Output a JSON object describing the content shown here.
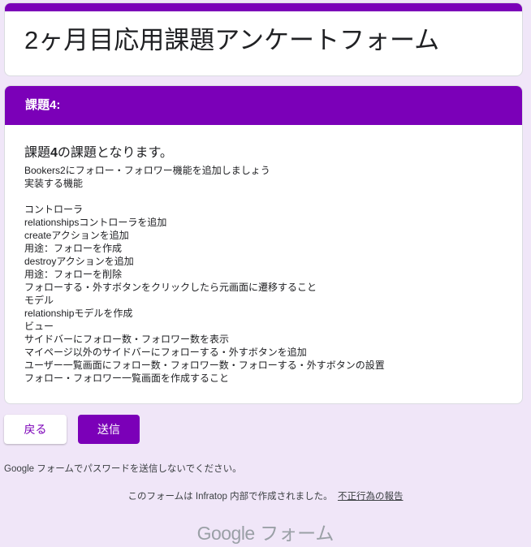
{
  "form": {
    "title": "2ヶ月目応用課題アンケートフォーム"
  },
  "section": {
    "header": "課題4:",
    "heading_prefix": "課題",
    "heading_num": "4",
    "heading_suffix": "の課題となります。",
    "lines": [
      "Bookers2にフォロー・フォロワー機能を追加しましょう",
      "実装する機能",
      "",
      "コントローラ",
      "relationshipsコントローラを追加",
      "createアクションを追加",
      "用途：フォローを作成",
      "destroyアクションを追加",
      "用途：フォローを削除",
      "フォローする・外すボタンをクリックしたら元画面に遷移すること",
      "モデル",
      "relationshipモデルを作成",
      "ビュー",
      "サイドバーにフォロー数・フォロワー数を表示",
      "マイページ以外のサイドバーにフォローする・外すボタンを追加",
      "ユーザー一覧画面にフォロー数・フォロワー数・フォローする・外すボタンの設置",
      "フォロー・フォロワー一覧画面を作成すること"
    ]
  },
  "buttons": {
    "back": "戻る",
    "submit": "送信"
  },
  "notice": "Google フォームでパスワードを送信しないでください。",
  "footer": {
    "text": "このフォームは Infratop 内部で作成されました。",
    "report_link": "不正行為の報告"
  },
  "brand": {
    "google": "Google",
    "forms": "フォーム"
  },
  "colors": {
    "accent": "#7b00b8",
    "background": "#f0e6f8"
  }
}
